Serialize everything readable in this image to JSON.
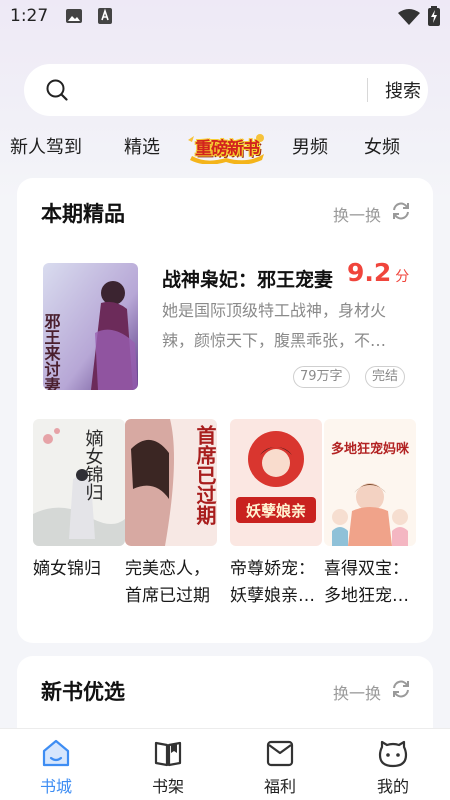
{
  "status_bar": {
    "time": "1:27"
  },
  "search": {
    "placeholder": "",
    "button_label": "搜索"
  },
  "categories": {
    "tabs": [
      "新人驾到",
      "精选",
      "男频",
      "女频"
    ],
    "banner_label": "重磅新书"
  },
  "featured_section": {
    "title": "本期精品",
    "refresh_label": "换一换",
    "book": {
      "title": "战神枭妃：邪王宠妻",
      "score": "9.2",
      "score_unit": "分",
      "description": "她是国际顶级特工战神，身材火辣，颜惊天下，腹黑乖张，不按常理出牌的女人",
      "word_count": "79万字",
      "status": "完结",
      "cover_text": "邪王来讨妻"
    },
    "grid_books": [
      {
        "title": "嫡女锦归",
        "cover_text": "嫡女锦归"
      },
      {
        "title": "完美恋人，首席已过期",
        "cover_text": "首席已过期"
      },
      {
        "title": "帝尊娇宠：妖孽娘亲镇九天",
        "cover_text": "妖孽娘亲"
      },
      {
        "title": "喜得双宝：多地狂宠妈咪",
        "cover_text": "多地狂宠妈咪"
      }
    ]
  },
  "new_books_section": {
    "title": "新书优选",
    "refresh_label": "换一换"
  },
  "bottom_nav": {
    "items": [
      {
        "label": "书城",
        "icon": "home-icon"
      },
      {
        "label": "书架",
        "icon": "bookshelf-icon"
      },
      {
        "label": "福利",
        "icon": "gift-envelope-icon"
      },
      {
        "label": "我的",
        "icon": "profile-icon"
      }
    ],
    "active_index": 0
  },
  "colors": {
    "accent": "#3e8df3",
    "score": "#f0453c",
    "muted": "#9a9a9a"
  }
}
